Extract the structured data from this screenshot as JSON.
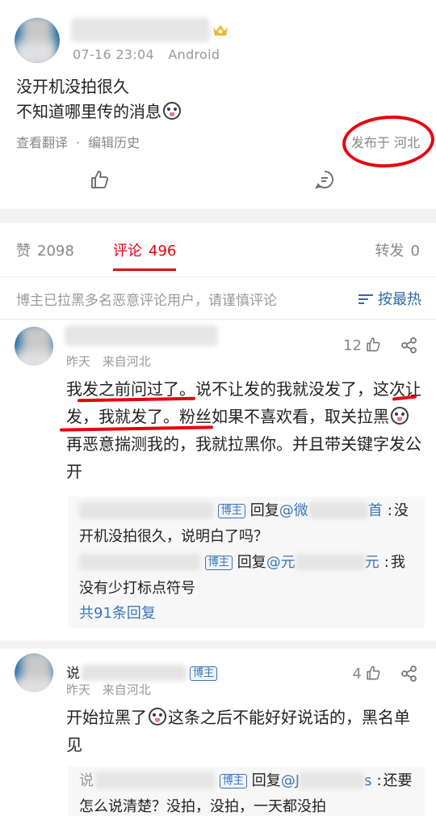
{
  "post": {
    "time": "07-16 23:04",
    "device": "Android",
    "body_line1": "没开机没拍很久",
    "body_line2": "不知道哪里传的消息",
    "translate_label": "查看翻译",
    "separator": "·",
    "edit_history_label": "编辑历史",
    "location": "发布于 河北"
  },
  "stats": {
    "likes_label": "赞",
    "likes_count": "2098",
    "comments_label": "评论",
    "comments_count": "496",
    "reposts_label": "转发",
    "reposts_count": "0"
  },
  "notice": {
    "text": "博主已拉黑多名恶意评论用户，请谨慎评论",
    "sort_label": "按最热"
  },
  "comments": [
    {
      "time": "昨天",
      "from": "来自河北",
      "likes": "12",
      "text_p1": "我发之前问过了。说不让发的我就没发了，这次让发，我就发了。粉丝如果不喜欢看，取关拉黑",
      "text_p2": "再恶意揣测我的，我就拉黑你。并且带关键字发公开",
      "replies": [
        {
          "badge": "博主",
          "prefix": "回复",
          "at": "@微",
          "at_tail": "首",
          "sep": ":",
          "text": "没开机没拍很久，说明白了吗？"
        },
        {
          "badge": "博主",
          "prefix": "回复",
          "at": "@元",
          "at_tail": "元",
          "sep": ":",
          "text": "我没有少打标点符号"
        }
      ],
      "more": "共91条回复"
    },
    {
      "name_char": "说",
      "badge": "博主",
      "time": "昨天",
      "from": "来自河北",
      "likes": "4",
      "text_p1": "开始拉黑了",
      "text_p2": "这条之后不能好好说话的，黑名单见",
      "reply": {
        "lead": "说",
        "badge": "博主",
        "prefix": "回复",
        "at": "@J",
        "at_tail": "s",
        "sep": ":",
        "text": "还要怎么说清楚？没拍，没拍，一天都没拍"
      }
    }
  ]
}
